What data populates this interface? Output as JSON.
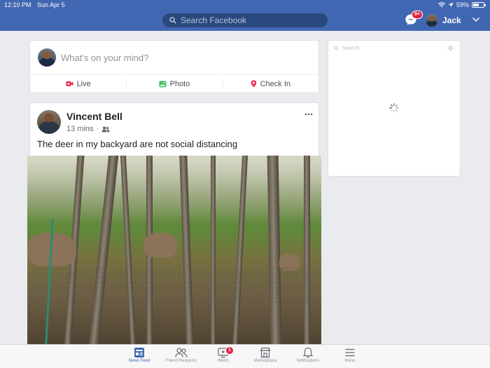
{
  "status_bar": {
    "time": "12:10 PM",
    "date": "Sun Apr 5",
    "battery_percent": "59%",
    "battery_level": 0.59
  },
  "nav": {
    "search_placeholder": "Search Facebook",
    "messenger_badge": "9+",
    "profile_name": "Jack"
  },
  "composer": {
    "prompt": "What's on your mind?",
    "actions": [
      {
        "label": "Live",
        "icon": "live-video-icon",
        "color": "#f02849"
      },
      {
        "label": "Photo",
        "icon": "photo-icon",
        "color": "#45bd62"
      },
      {
        "label": "Check In",
        "icon": "location-pin-icon",
        "color": "#f02849"
      }
    ]
  },
  "right_panel": {
    "search_label": "Search"
  },
  "post": {
    "author": "Vincent Bell",
    "time_ago": "13 mins",
    "separator": "·",
    "audience_icon": "friends-icon",
    "text": "The deer in my backyard are not social distancing"
  },
  "tabbar": {
    "tabs": [
      {
        "label": "News Feed",
        "icon": "news-feed-icon",
        "active": true
      },
      {
        "label": "Friend Requests",
        "icon": "friend-requests-icon",
        "active": false
      },
      {
        "label": "Watch",
        "icon": "watch-icon",
        "active": false,
        "badge": "1"
      },
      {
        "label": "Marketplace",
        "icon": "marketplace-icon",
        "active": false
      },
      {
        "label": "Notifications",
        "icon": "bell-icon",
        "active": false
      },
      {
        "label": "Menu",
        "icon": "hamburger-menu-icon",
        "active": false
      }
    ]
  },
  "colors": {
    "brand_blue": "#4267b2",
    "badge_red": "#e41e3f",
    "background": "#e9ebee"
  }
}
